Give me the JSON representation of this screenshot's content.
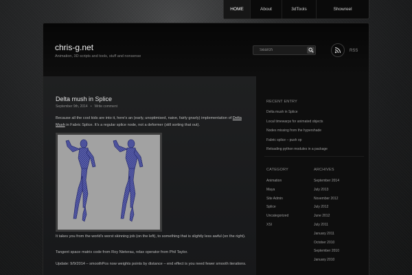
{
  "nav": {
    "items": [
      {
        "label": "HOME",
        "active": true
      },
      {
        "label": "About",
        "active": false
      },
      {
        "label": "3dTools",
        "active": false
      },
      {
        "label": "Showreel",
        "active": false
      }
    ]
  },
  "header": {
    "site_title": "chris-g.net",
    "tagline": "Animation, 3D scripts and tools, stuff and nonsense",
    "search_placeholder": "Search",
    "rss_label": "RSS"
  },
  "post": {
    "title": "Delta mush in Splice",
    "date": "September 9th, 2014",
    "separator": "•",
    "comment_link": "Write comment",
    "p1_before": "Because all the cool kids are into it, here's an (early, unoptimised, naive, fairly gnarly) implementation of ",
    "p1_link": "Delta Mush",
    "p1_after": " in Fabric Splice. It's a regular splice node, not a deformer (still sorting that out).",
    "p2": "It takes you from the world's worst skinning job (on the left), to something that is slightly less awful (on the right).",
    "p3": "Tangent space matrix code from Roy Nieterau, relax operator from Phil Taylor.",
    "p4": "Update: 9/9/2014 – smoothPos now weights points by distance – end effect is you need fewer smooth iterations."
  },
  "sidebar": {
    "recent_title": "RECENT ENTRY",
    "recent": [
      "Delta mush in Splice",
      "Local timewarps for animated objects",
      "Nodes missing from the hypershade",
      "Fabric splice – push op",
      "Reloading python modules in a package"
    ],
    "category_title": "CATEGORY",
    "categories": [
      "Animation",
      "Maya",
      "Site Admin",
      "Splice",
      "Uncategorized",
      "XSI"
    ],
    "archives_title": "ARCHIVES",
    "archives": [
      "September 2014",
      "July 2013",
      "November 2012",
      "July 2012",
      "June 2012",
      "July 2011",
      "January 2011",
      "October 2010",
      "September 2010",
      "January 2010"
    ]
  },
  "colors": {
    "accent_link": "#d0d0d0",
    "figure_bg": "#a2a2a2",
    "mesh_fill": "#5a5fa6",
    "mesh_line": "#2a2f80"
  }
}
